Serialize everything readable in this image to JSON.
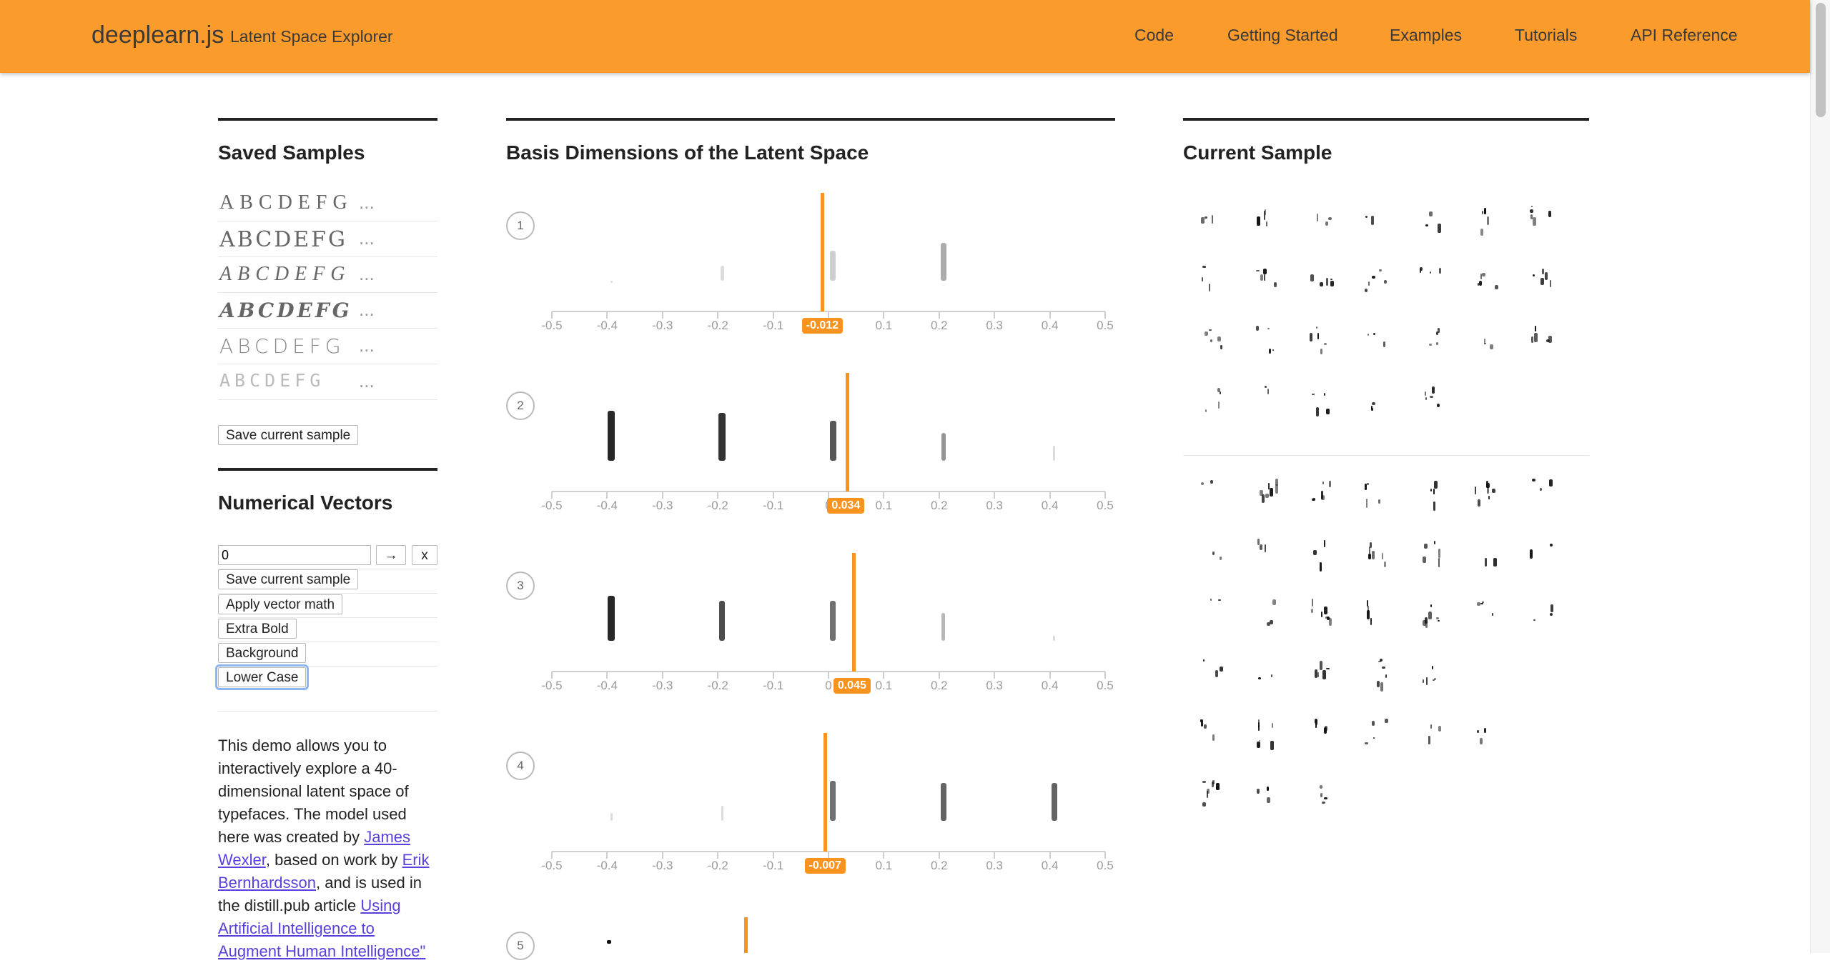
{
  "header": {
    "brand": "deeplearn.js",
    "subtitle": "Latent Space Explorer",
    "nav": [
      "Code",
      "Getting Started",
      "Examples",
      "Tutorials",
      "API Reference"
    ]
  },
  "saved_samples": {
    "title": "Saved Samples",
    "rows": [
      {
        "letters": "ABCDEFG",
        "more": "..."
      },
      {
        "letters": "ABCDEFG",
        "more": "..."
      },
      {
        "letters": "ABCDEFG",
        "more": "..."
      },
      {
        "letters": "ABCDEFG",
        "more": "..."
      },
      {
        "letters": "ABCDEFG",
        "more": "..."
      },
      {
        "letters": "ABCDEFG",
        "more": "..."
      }
    ],
    "save_button": "Save current sample"
  },
  "numerical_vectors": {
    "title": "Numerical Vectors",
    "input_value": "0",
    "go_button": "→",
    "clear_button": "x",
    "items": [
      "Save current sample",
      "Apply vector math",
      "Extra Bold",
      "Background",
      "Lower Case"
    ]
  },
  "description": {
    "text1": "This demo allows you to interactively explore a 40-dimensional latent space of typefaces. The model used here was created by ",
    "link1": "James Wexler",
    "text2": ", based on work by ",
    "link2": "Erik Bernhardsson",
    "text3": ", and is used in the distill.pub article ",
    "link3": "Using Artificial Intelligence to Augment Human Intelligence\""
  },
  "basis": {
    "title": "Basis Dimensions of the Latent Space",
    "tick_labels": [
      "-0.5",
      "-0.4",
      "-0.3",
      "-0.2",
      "-0.1",
      "0",
      "0.1",
      "0.2",
      "0.3",
      "0.4",
      "0.5"
    ],
    "dimensions": [
      {
        "index": "1",
        "value": "-0.012",
        "position": -0.012
      },
      {
        "index": "2",
        "value": "0.034",
        "position": 0.034
      },
      {
        "index": "3",
        "value": "0.045",
        "position": 0.045
      },
      {
        "index": "4",
        "value": "-0.007",
        "position": -0.007
      },
      {
        "index": "5",
        "value": "",
        "position": -0.15
      }
    ]
  },
  "current_sample": {
    "title": "Current Sample"
  },
  "colors": {
    "header": "#fb9b2b",
    "slider": "#f7931e",
    "link": "#5a3fe0"
  }
}
